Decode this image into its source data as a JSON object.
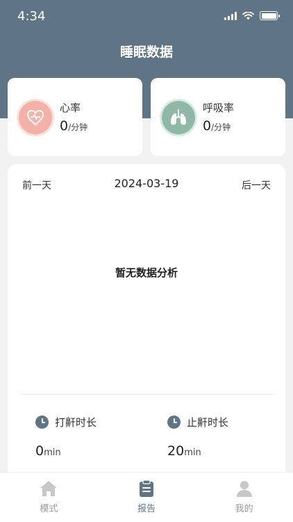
{
  "status_bar": {
    "time": "4:34"
  },
  "header": {
    "title": "睡眠数据"
  },
  "metrics": {
    "heart_rate": {
      "label": "心率",
      "value": "0",
      "unit": "/分钟"
    },
    "respiration": {
      "label": "呼吸率",
      "value": "0",
      "unit": "/分钟"
    }
  },
  "day_nav": {
    "prev": "前一天",
    "date": "2024-03-19",
    "next": "后一天"
  },
  "analysis": {
    "empty_text": "暂无数据分析"
  },
  "stats": {
    "snore": {
      "label": "打鼾时长",
      "value": "0",
      "unit": "min"
    },
    "stop_snore": {
      "label": "止鼾时长",
      "value": "20",
      "unit": "min"
    }
  },
  "tabbar": {
    "items": [
      {
        "label": "模式",
        "icon": "home-icon"
      },
      {
        "label": "报告",
        "icon": "clipboard-icon",
        "active": true
      },
      {
        "label": "我的",
        "icon": "user-icon"
      }
    ]
  },
  "colors": {
    "header": "#5f7585",
    "heart": "#f3b1a8",
    "lung": "#8fb9a6"
  }
}
